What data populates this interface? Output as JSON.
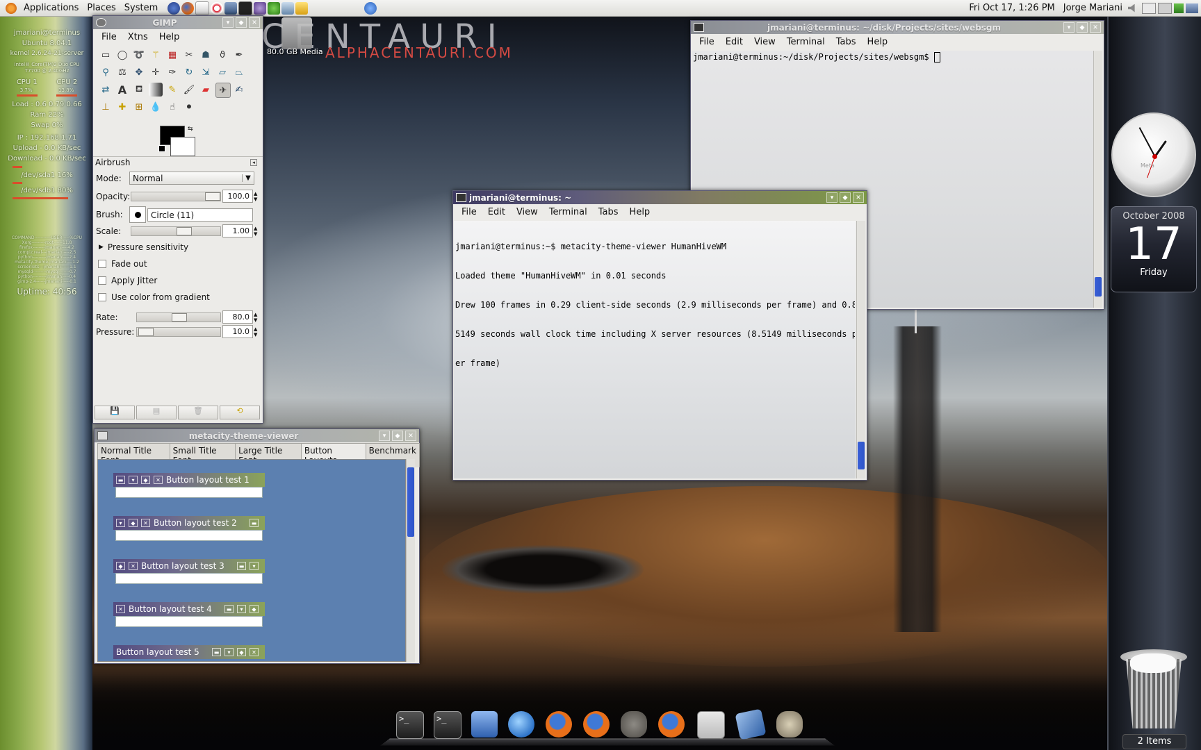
{
  "top_panel": {
    "menus": [
      "Applications",
      "Places",
      "System"
    ],
    "clock": "Fri Oct 17,  1:26 PM",
    "user": "Jorge Mariani"
  },
  "conky": {
    "user_host": "jmariani@terminus",
    "distro": "Ubuntu 8.04.1",
    "kernel": "kernel 2.6.24-21-server",
    "cpu_model": "Intel® Core(TM)2 Duo CPU T7700 @ 2.40GHz",
    "cpu1_label": "CPU 1",
    "cpu2_label": "CPU 2",
    "cpu1_pct": "3.7%",
    "cpu2_pct": "13.8%",
    "load": "Load : 0.6 0.79 0.66",
    "ram": "Ram 22%",
    "swap": "Swap 0%",
    "ip": "IP : 192.168.1.71",
    "upload": "Upload - 0.0 KB/sec",
    "download": "Download - 0.0 KB/sec",
    "disk1": "/dev/sda1 16%",
    "disk2": "/dev/sdb1 80%",
    "proc_header": "COMMAND-----------USER-----%CPU",
    "procs": [
      "Xorg---------root------11.8",
      "firefox--------jmariani----4.2",
      "compiz.real---jmariani----2.5",
      "python---------jmariani----2.4",
      "metacity-theme-jmariani----1.2",
      "screenlets---jmariani------1.1",
      "mysqld---------mysql-------0.7",
      "python---------jmariani----0.4",
      "gimp-2.4------jmariani-----0.1"
    ],
    "uptime": "Uptime: 40:56"
  },
  "desktop": {
    "logo_text": "CENTAURI",
    "logo_url": "ALPHACENTAURI.COM",
    "drive_label": "80.0 GB Media"
  },
  "gimp": {
    "title": "GIMP",
    "menus": [
      "File",
      "Xtns",
      "Help"
    ],
    "tool_name": "Airbrush",
    "mode_label": "Mode:",
    "mode_value": "Normal",
    "opacity_label": "Opacity:",
    "opacity_value": "100.0",
    "opacity_fraction": 1.0,
    "brush_label": "Brush:",
    "brush_value": "Circle (11)",
    "scale_label": "Scale:",
    "scale_value": "1.00",
    "pressure_sens": "Pressure sensitivity",
    "fade_out": "Fade out",
    "apply_jitter": "Apply Jitter",
    "use_gradient": "Use color from gradient",
    "rate_label": "Rate:",
    "rate_value": "80.0",
    "pressure_label": "Pressure:",
    "pressure_value": "10.0"
  },
  "term_back": {
    "title": "jmariani@terminus: ~/disk/Projects/sites/websgm",
    "menus": [
      "File",
      "Edit",
      "View",
      "Terminal",
      "Tabs",
      "Help"
    ],
    "prompt": "jmariani@terminus:~/disk/Projects/sites/websgm$ "
  },
  "term_front": {
    "title": "jmariani@terminus: ~",
    "menus": [
      "File",
      "Edit",
      "View",
      "Terminal",
      "Tabs",
      "Help"
    ],
    "lines": [
      "jmariani@terminus:~$ metacity-theme-viewer HumanHiveWM",
      "Loaded theme \"HumanHiveWM\" in 0.01 seconds",
      "Drew 100 frames in 0.29 client-side seconds (2.9 milliseconds per frame) and 0.8",
      "5149 seconds wall clock time including X server resources (8.5149 milliseconds p",
      "er frame)"
    ]
  },
  "theme_viewer": {
    "title": "metacity-theme-viewer",
    "tabs": [
      "Normal Title Font",
      "Small Title Font",
      "Large Title Font",
      "Button Layouts",
      "Benchmark"
    ],
    "tests": [
      "Button layout test 1",
      "Button layout test 2",
      "Button layout test 3",
      "Button layout test 4",
      "Button layout test 5"
    ]
  },
  "widgets": {
    "cal_month": "October 2008",
    "cal_day": "17",
    "cal_weekday": "Friday",
    "clock_brand": "Meta",
    "trash_label": "2 Items"
  },
  "dock": {
    "icons": [
      "terminal-icon",
      "terminal-icon",
      "file-manager-icon",
      "pidgin-icon",
      "firefox-icon",
      "firefox-icon",
      "gimp-icon",
      "firefox-icon",
      "window-icon",
      "screenshot-icon",
      "mixer-icon"
    ]
  }
}
